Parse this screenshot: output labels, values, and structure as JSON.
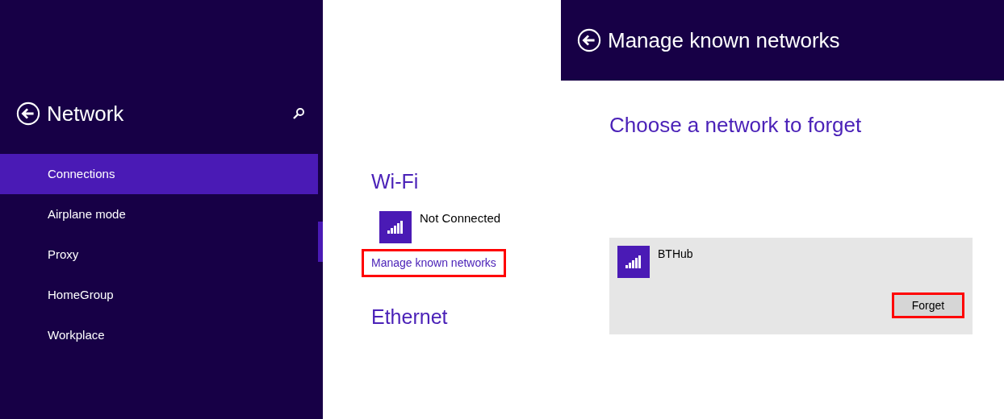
{
  "sidebar": {
    "title": "Network",
    "items": [
      {
        "label": "Connections",
        "selected": true
      },
      {
        "label": "Airplane mode",
        "selected": false
      },
      {
        "label": "Proxy",
        "selected": false
      },
      {
        "label": "HomeGroup",
        "selected": false
      },
      {
        "label": "Workplace",
        "selected": false
      }
    ]
  },
  "connections": {
    "wifi_heading": "Wi-Fi",
    "wifi_status": "Not Connected",
    "manage_link": {
      "label": "Manage known networks",
      "highlighted": true
    },
    "ethernet_heading": "Ethernet"
  },
  "manage_page": {
    "title": "Manage known networks",
    "heading": "Choose a network to forget",
    "networks": [
      {
        "name": "BTHub",
        "forget_button": {
          "label": "Forget",
          "highlighted": true
        }
      }
    ]
  }
}
